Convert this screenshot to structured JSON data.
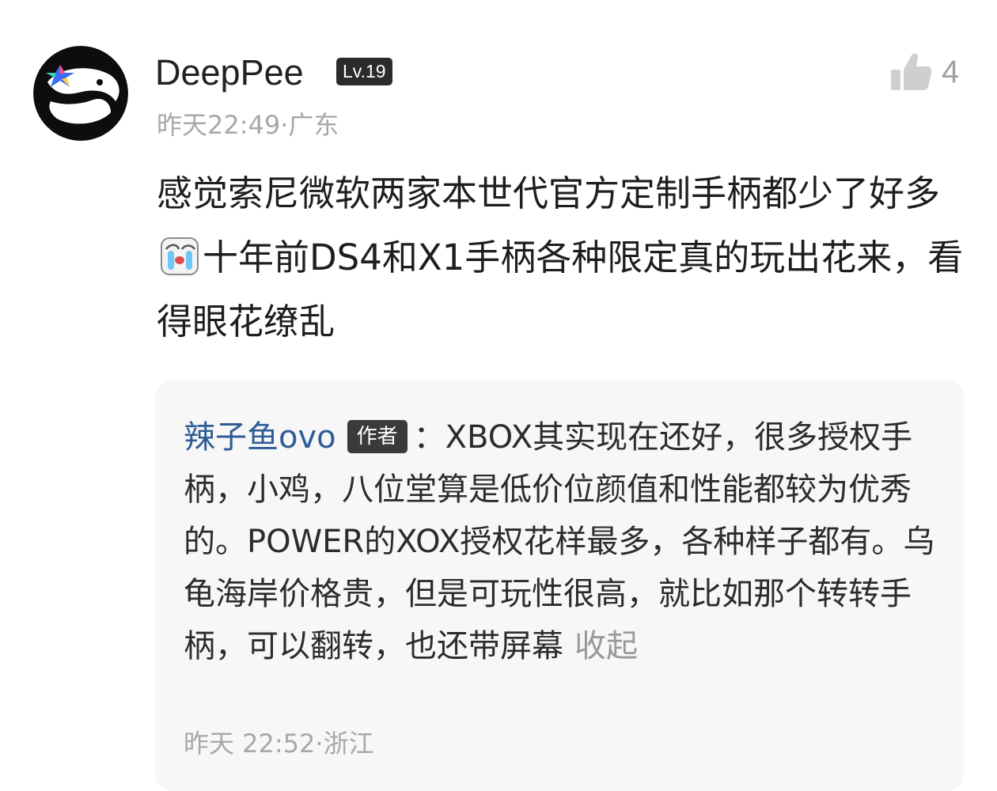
{
  "comment": {
    "avatar_icon": "whale-avatar-icon",
    "username": "DeepPee",
    "level": "Lv.19",
    "time": "昨天22:49",
    "location": "广东",
    "like_icon": "thumbs-up-icon",
    "likes": "4",
    "text_before_emoji": "感觉索尼微软两家本世代官方定制手柄都少了好多",
    "emoji_icon": "crying-face-icon",
    "text_after_emoji": "十年前DS4和X1手柄各种限定真的玩出花来，看得眼花缭乱"
  },
  "reply": {
    "username": "辣子鱼ovo",
    "badge": "作者",
    "separator": "：",
    "text": "XBOX其实现在还好，很多授权手柄，小鸡，八位堂算是低价位颜值和性能都较为优秀的。POWER的XOX授权花样最多，各种样子都有。乌龟海岸价格贵，但是可玩性很高，就比如那个转转手柄，可以翻转，也还带屏幕",
    "collapse_label": "收起",
    "time": "昨天 22:52",
    "location": "浙江"
  },
  "colors": {
    "reply_username": "#2f5c96",
    "meta_gray": "#a8a8a8",
    "badge_dark": "#2b2b2b",
    "reply_bg": "#f7f7f8"
  }
}
